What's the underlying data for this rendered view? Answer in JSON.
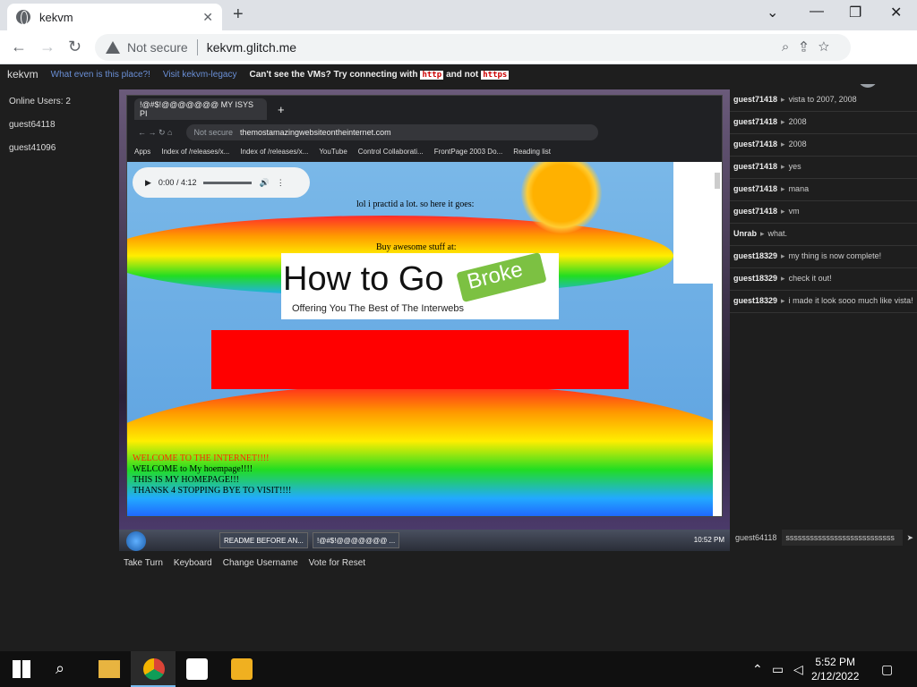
{
  "browser": {
    "tab_title": "kekvm",
    "tab_close": "✕",
    "new_tab": "+",
    "win_min": "—",
    "win_max": "❐",
    "win_close": "✕",
    "chevron": "⌄",
    "not_secure": "Not secure",
    "url": "kekvm.glitch.me"
  },
  "site": {
    "brand": "kekvm",
    "link_what": "What even is this place?!",
    "link_legacy": "Visit kekvm-legacy",
    "msg_part1": "Can't see the VMs? Try connecting with",
    "code_http": "http",
    "msg_and": "and not",
    "code_https": "https"
  },
  "users": {
    "count_label": "Online Users: 2",
    "list": [
      "guest64118",
      "guest41096"
    ]
  },
  "vm": {
    "tab_title": "!@#$!@@@@@@@ MY ISYS PI",
    "not_secure": "Not secure",
    "url": "themostamazingwebsiteontheinternet.com",
    "bookmarks": [
      "Apps",
      "Index of /releases/x...",
      "Index of /releases/x...",
      "YouTube",
      "Control Collaborati...",
      "FrontPage 2003 Do...",
      "Reading list"
    ],
    "audio_time": "0:00 / 4:12",
    "practid": "lol i practid a lot. so here it goes:",
    "buy": "Buy awesome stuff at:",
    "logo_main": "How to Go",
    "logo_tag": "Broke",
    "logo_sub": "Offering You The Best of The Interwebs",
    "welcome": [
      {
        "text": "WELCOME TO THE INTERNET!!!!",
        "color": "#ff2b00"
      },
      {
        "text": "WELCOME to My hoempage!!!!",
        "color": "#000000"
      },
      {
        "text": "THIS IS MY HOMEPAGE!!!",
        "color": "#000000"
      },
      {
        "text": "THANSK 4 STOPPING BYE TO VISIT!!!!",
        "color": "#000000"
      }
    ],
    "task1": "README BEFORE AN...",
    "task2": "!@#$!@@@@@@@ ...",
    "clock": "10:52 PM"
  },
  "controls": [
    "Take Turn",
    "Keyboard",
    "Change Username",
    "Vote for Reset"
  ],
  "chat": [
    {
      "who": "guest71418",
      "text": "vista to 2007, 2008"
    },
    {
      "who": "guest71418",
      "text": "2008"
    },
    {
      "who": "guest71418",
      "text": "2008"
    },
    {
      "who": "guest71418",
      "text": "yes"
    },
    {
      "who": "guest71418",
      "text": "mana"
    },
    {
      "who": "guest71418",
      "text": "vm"
    },
    {
      "who": "Unrab",
      "text": "what."
    },
    {
      "who": "guest18329",
      "text": "my thing is now complete!"
    },
    {
      "who": "guest18329",
      "text": "check it out!"
    },
    {
      "who": "guest18329",
      "text": "i made it look sooo much like vista!"
    }
  ],
  "chat_input": {
    "username": "guest64118",
    "value": "sssssssssssssssssssssssssss"
  },
  "taskbar": {
    "time": "5:52 PM",
    "date": "2/12/2022"
  },
  "colors": {
    "accent_link": "#6a8fd6",
    "red_box": "#ff0000",
    "code_text": "#cc0000"
  }
}
